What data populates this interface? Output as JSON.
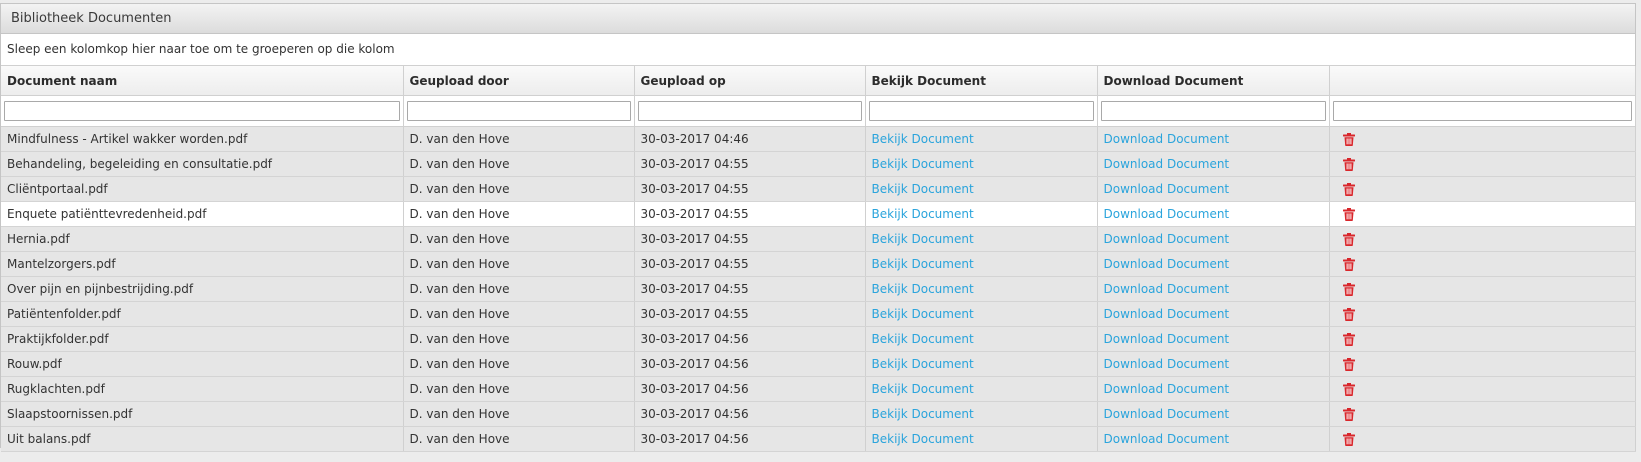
{
  "panel": {
    "title": "Bibliotheek Documenten"
  },
  "group_hint": "Sleep een kolomkop hier naar toe om te groeperen op die kolom",
  "columns": {
    "name": "Document naam",
    "uploader": "Geupload door",
    "uploaded_on": "Geupload op",
    "view": "Bekijk Document",
    "download": "Download Document",
    "actions": ""
  },
  "filters": {
    "name": "",
    "uploader": "",
    "uploaded_on": "",
    "view": "",
    "download": "",
    "actions": ""
  },
  "view_link_label": "Bekijk Document",
  "download_link_label": "Download Document",
  "delete_icon": "trash-icon",
  "colors": {
    "link": "#2aa4dc",
    "delete": "#d9262b",
    "row_gray": "#e6e6e6",
    "row_white": "#ffffff"
  },
  "rows": [
    {
      "name": "Mindfulness - Artikel wakker worden.pdf",
      "uploader": "D. van den Hove",
      "date": "30-03-2017 04:46"
    },
    {
      "name": "Behandeling, begeleiding en consultatie.pdf",
      "uploader": "D. van den Hove",
      "date": "30-03-2017 04:55"
    },
    {
      "name": "Cliëntportaal.pdf",
      "uploader": "D. van den Hove",
      "date": "30-03-2017 04:55"
    },
    {
      "name": "Enquete patiënttevredenheid.pdf",
      "uploader": "D. van den Hove",
      "date": "30-03-2017 04:55",
      "highlighted": true
    },
    {
      "name": "Hernia.pdf",
      "uploader": "D. van den Hove",
      "date": "30-03-2017 04:55"
    },
    {
      "name": "Mantelzorgers.pdf",
      "uploader": "D. van den Hove",
      "date": "30-03-2017 04:55"
    },
    {
      "name": "Over pijn en pijnbestrijding.pdf",
      "uploader": "D. van den Hove",
      "date": "30-03-2017 04:55"
    },
    {
      "name": "Patiëntenfolder.pdf",
      "uploader": "D. van den Hove",
      "date": "30-03-2017 04:55"
    },
    {
      "name": "Praktijkfolder.pdf",
      "uploader": "D. van den Hove",
      "date": "30-03-2017 04:56"
    },
    {
      "name": "Rouw.pdf",
      "uploader": "D. van den Hove",
      "date": "30-03-2017 04:56"
    },
    {
      "name": "Rugklachten.pdf",
      "uploader": "D. van den Hove",
      "date": "30-03-2017 04:56"
    },
    {
      "name": "Slaapstoornissen.pdf",
      "uploader": "D. van den Hove",
      "date": "30-03-2017 04:56"
    },
    {
      "name": "Uit balans.pdf",
      "uploader": "D. van den Hove",
      "date": "30-03-2017 04:56"
    }
  ]
}
